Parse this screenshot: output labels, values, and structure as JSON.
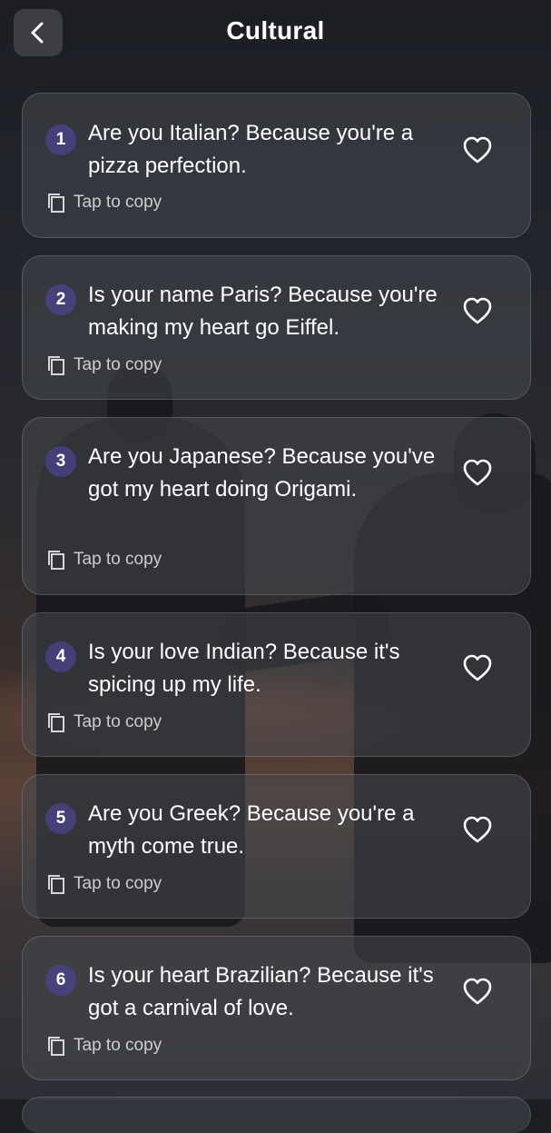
{
  "header": {
    "title": "Cultural"
  },
  "cards": [
    {
      "number": "1",
      "text": "Are you Italian? Because you're a pizza perfection.",
      "copy_label": "Tap to copy"
    },
    {
      "number": "2",
      "text": "Is your name Paris? Because you're making my heart go Eiffel.",
      "copy_label": "Tap to copy"
    },
    {
      "number": "3",
      "text": "Are you Japanese? Because you've got my heart doing Origami.",
      "copy_label": "Tap to copy"
    },
    {
      "number": "4",
      "text": "Is your love Indian? Because it's spicing up my life.",
      "copy_label": "Tap to copy"
    },
    {
      "number": "5",
      "text": "Are you Greek? Because you're a myth come true.",
      "copy_label": "Tap to copy"
    },
    {
      "number": "6",
      "text": "Is your heart Brazilian? Because it's got a carnival of love.",
      "copy_label": "Tap to copy"
    }
  ],
  "icons": {
    "back": "chevron-left-icon",
    "copy": "copy-icon",
    "favorite": "heart-outline-icon"
  }
}
